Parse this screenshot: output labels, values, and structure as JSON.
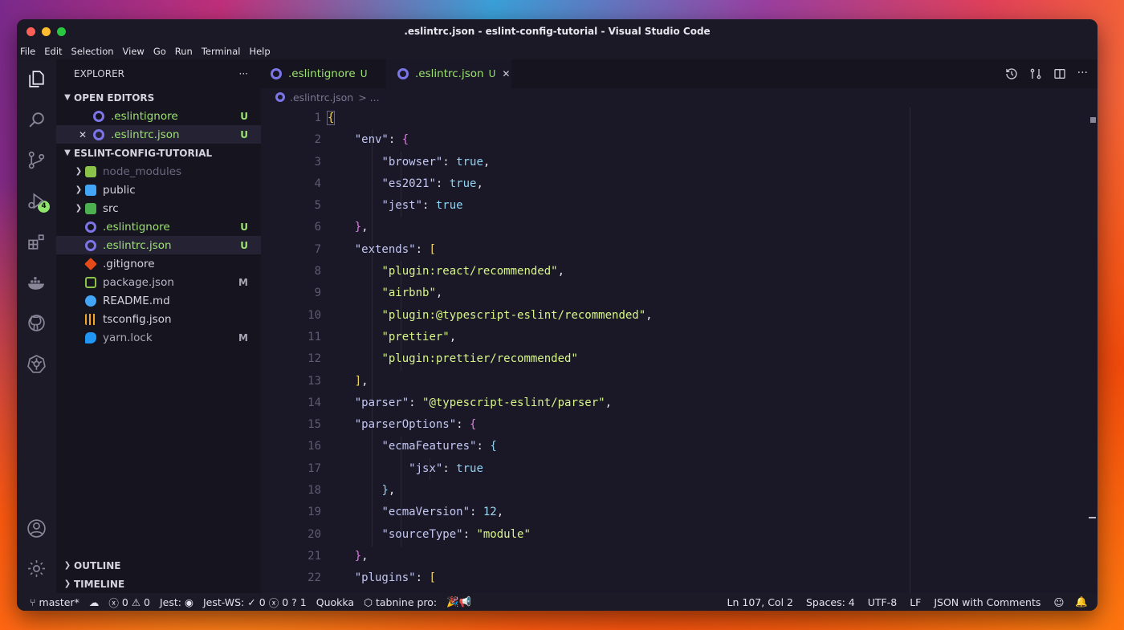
{
  "window": {
    "title": ".eslintrc.json - eslint-config-tutorial - Visual Studio Code"
  },
  "menu": [
    "File",
    "Edit",
    "Selection",
    "View",
    "Go",
    "Run",
    "Terminal",
    "Help"
  ],
  "activity_bar": {
    "icons": [
      "files-icon",
      "search-icon",
      "source-control-icon",
      "run-debug-icon",
      "extensions-icon",
      "docker-icon",
      "github-icon",
      "kubernetes-icon",
      "account-icon",
      "settings-icon"
    ],
    "source_control_badge": "4"
  },
  "sidebar": {
    "title": "EXPLORER",
    "more": "···",
    "open_editors": {
      "label": "OPEN EDITORS",
      "items": [
        {
          "name": ".eslintignore",
          "status": "U"
        },
        {
          "name": ".eslintrc.json",
          "status": "U",
          "close": "✕"
        }
      ]
    },
    "project": {
      "label": "ESLINT-CONFIG-TUTORIAL",
      "items": [
        {
          "name": "node_modules",
          "status": ""
        },
        {
          "name": "public",
          "status": ""
        },
        {
          "name": "src",
          "status": ""
        },
        {
          "name": ".eslintignore",
          "status": "U"
        },
        {
          "name": ".eslintrc.json",
          "status": "U"
        },
        {
          "name": ".gitignore",
          "status": ""
        },
        {
          "name": "package.json",
          "status": "M"
        },
        {
          "name": "README.md",
          "status": ""
        },
        {
          "name": "tsconfig.json",
          "status": ""
        },
        {
          "name": "yarn.lock",
          "status": "M"
        }
      ]
    },
    "outline": "OUTLINE",
    "timeline": "TIMELINE"
  },
  "tabs": [
    {
      "name": ".eslintignore",
      "status": "U"
    },
    {
      "name": ".eslintrc.json",
      "status": "U",
      "close": "✕"
    }
  ],
  "breadcrumb": {
    "file": ".eslintrc.json",
    "rest": "> ..."
  },
  "code": {
    "line_numbers": [
      "1",
      "2",
      "3",
      "4",
      "5",
      "6",
      "7",
      "8",
      "9",
      "10",
      "11",
      "12",
      "13",
      "14",
      "15",
      "16",
      "17",
      "18",
      "19",
      "20",
      "21",
      "22"
    ]
  },
  "status": {
    "branch": "master*",
    "errors": "0",
    "warnings": "0",
    "jest": "Jest:",
    "jest_ws": "Jest-WS:",
    "jest_ws_pass": "0",
    "jest_ws_fail": "0",
    "jest_ws_unknown": "1",
    "quokka": "Quokka",
    "tabnine": "tabnine pro:",
    "tabnine_emoji": "🎉📢",
    "cursor": "Ln 107, Col 2",
    "spaces": "Spaces: 4",
    "encoding": "UTF-8",
    "eol": "LF",
    "language": "JSON with Comments"
  },
  "colors": {
    "accent": "#9ce46f",
    "bg": "#1a1826"
  }
}
